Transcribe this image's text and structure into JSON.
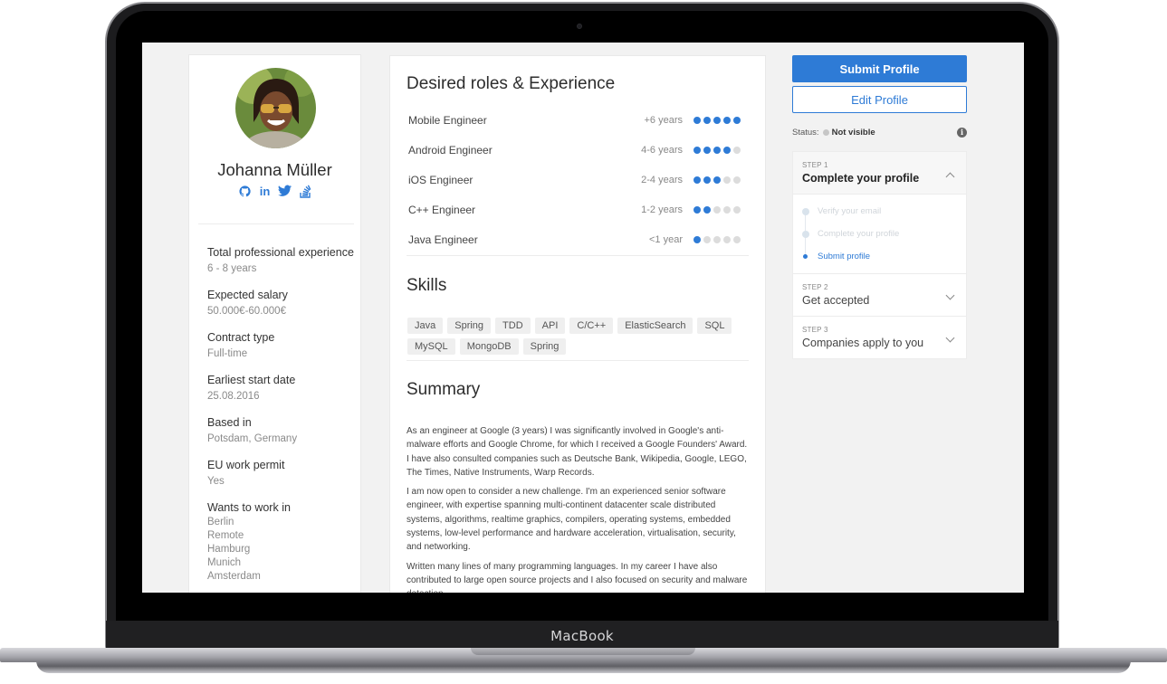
{
  "device": {
    "brand": "MacBook"
  },
  "profile": {
    "name": "Johanna Müller",
    "socials": [
      "github-icon",
      "linkedin-icon",
      "twitter-icon",
      "stackoverflow-icon"
    ],
    "socials_text": {
      "linkedin": "in"
    },
    "facts": [
      {
        "label": "Total professional experience",
        "value": "6 - 8 years"
      },
      {
        "label": "Expected salary",
        "value": "50.000€-60.000€"
      },
      {
        "label": "Contract type",
        "value": "Full-time"
      },
      {
        "label": "Earliest start date",
        "value": "25.08.2016"
      },
      {
        "label": "Based in",
        "value": "Potsdam, Germany"
      },
      {
        "label": "EU work permit",
        "value": "Yes"
      }
    ],
    "wants_label": "Wants to work in",
    "wants": [
      "Berlin",
      "Remote",
      "Hamburg",
      "Munich",
      "Amsterdam"
    ]
  },
  "roles_section": {
    "title": "Desired roles & Experience",
    "roles": [
      {
        "name": "Mobile Engineer",
        "years": "+6 years",
        "level": 5
      },
      {
        "name": "Android Engineer",
        "years": "4-6 years",
        "level": 4
      },
      {
        "name": "iOS Engineer",
        "years": "2-4 years",
        "level": 3
      },
      {
        "name": "C++ Engineer",
        "years": "1-2 years",
        "level": 2
      },
      {
        "name": "Java Engineer",
        "years": "<1 year",
        "level": 1
      }
    ],
    "max_level": 5
  },
  "skills_section": {
    "title": "Skills",
    "skills": [
      "Java",
      "Spring",
      "TDD",
      "API",
      "C/C++",
      "ElasticSearch",
      "SQL",
      "MySQL",
      "MongoDB",
      "Spring"
    ]
  },
  "summary_section": {
    "title": "Summary",
    "paragraphs": [
      "As an engineer at Google (3 years) I was significantly involved in Google's anti-malware efforts and Google Chrome, for which I received a Google Founders' Award. I have also consulted companies such as Deutsche Bank, Wikipedia, Google, LEGO, The Times, Native Instruments, Warp Records.",
      "I am now open to consider a new challenge. I'm an experienced senior software engineer, with expertise spanning multi-continent datacenter scale distributed systems, algorithms, realtime graphics, compilers, operating systems, embedded systems, low-level performance and hardware acceleration, virtualisation, security, and networking.",
      "Written many lines of many programming languages. In my career I have also contributed to large open source projects and I also focused on security and malware detection."
    ]
  },
  "actions": {
    "submit_label": "Submit Profile",
    "edit_label": "Edit Profile"
  },
  "status": {
    "label": "Status:",
    "value": "Not visible",
    "info_icon": "info-icon",
    "info_glyph": "i"
  },
  "steps": [
    {
      "num": "STEP 1",
      "title": "Complete your profile",
      "expanded": true,
      "substeps": [
        {
          "label": "Verify your email",
          "state": "done"
        },
        {
          "label": "Complete your profile",
          "state": "done"
        },
        {
          "label": "Submit profile",
          "state": "current"
        }
      ]
    },
    {
      "num": "STEP 2",
      "title": "Get accepted",
      "expanded": false
    },
    {
      "num": "STEP 3",
      "title": "Companies apply to you",
      "expanded": false
    }
  ],
  "colors": {
    "accent": "#2e7bd6",
    "inactive_dot": "#dcdcdc",
    "background": "#f2f2f2"
  }
}
